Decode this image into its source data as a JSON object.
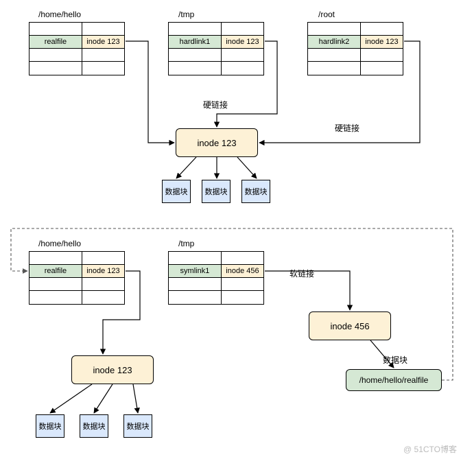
{
  "top": {
    "dir1": {
      "path": "/home/hello",
      "name": "realfile",
      "inode": "inode 123"
    },
    "dir2": {
      "path": "/tmp",
      "name": "hardlink1",
      "inode": "inode 123"
    },
    "dir3": {
      "path": "/root",
      "name": "hardlink2",
      "inode": "inode 123"
    },
    "link_label_12": "硬链接",
    "link_label_3": "硬链接",
    "inode": "inode 123",
    "block": "数据块"
  },
  "bottom": {
    "dir1": {
      "path": "/home/hello",
      "name": "realfile",
      "inode": "inode 123"
    },
    "dir2": {
      "path": "/tmp",
      "name": "symlink1",
      "inode": "inode 456"
    },
    "soft_label": "软链接",
    "inode_left": "inode 123",
    "inode_right": "inode 456",
    "block": "数据块",
    "right_block_label": "数据块",
    "target_path": "/home/hello/realfile"
  },
  "watermark": "@ 51CTO博客"
}
